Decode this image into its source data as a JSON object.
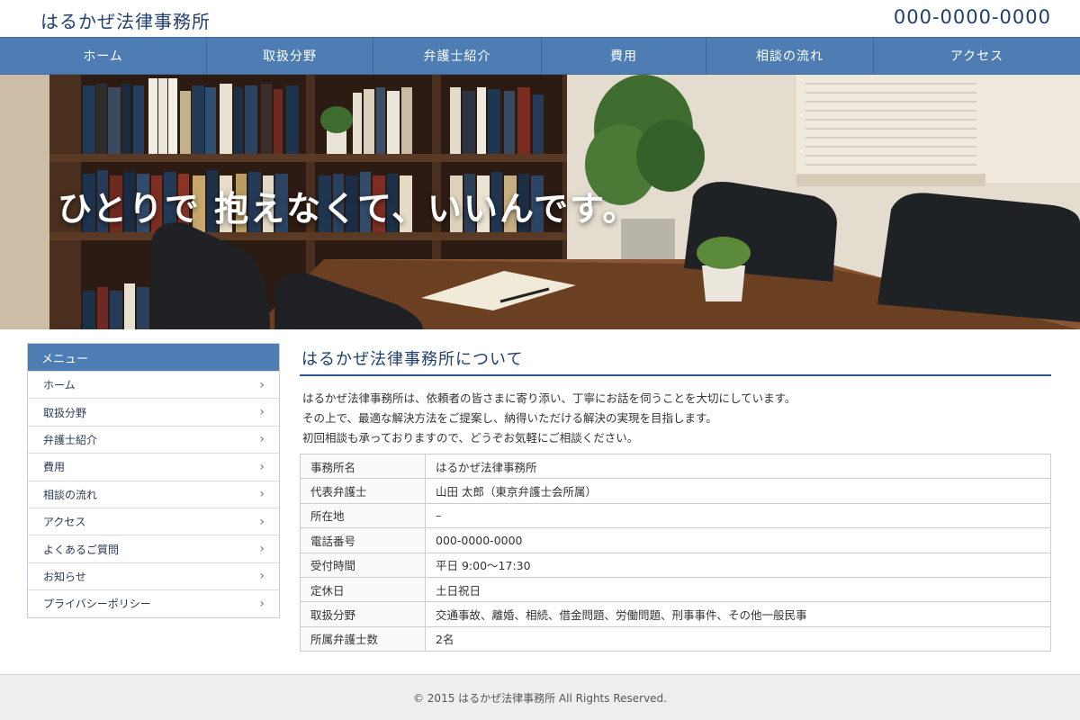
{
  "header": {
    "site_title": "はるかぜ法律事務所",
    "phone": "000-0000-0000"
  },
  "nav": {
    "items": [
      {
        "label": "ホーム"
      },
      {
        "label": "取扱分野"
      },
      {
        "label": "弁護士紹介"
      },
      {
        "label": "費用"
      },
      {
        "label": "相談の流れ"
      },
      {
        "label": "アクセス"
      }
    ]
  },
  "hero": {
    "copy": "ひとりで 抱えなくて、いいんです。"
  },
  "sidebar": {
    "heading": "メニュー",
    "chevron": "›",
    "items": [
      {
        "label": "ホーム"
      },
      {
        "label": "取扱分野"
      },
      {
        "label": "弁護士紹介"
      },
      {
        "label": "費用"
      },
      {
        "label": "相談の流れ"
      },
      {
        "label": "アクセス"
      },
      {
        "label": "よくあるご質問"
      },
      {
        "label": "お知らせ"
      },
      {
        "label": "プライバシーポリシー"
      }
    ]
  },
  "main": {
    "title": "はるかぜ法律事務所について",
    "intro": [
      "はるかぜ法律事務所は、依頼者の皆さまに寄り添い、丁寧にお話を伺うことを大切にしています。",
      "その上で、最適な解決方法をご提案し、納得いただける解決の実現を目指します。",
      "初回相談も承っておりますので、どうぞお気軽にご相談ください。"
    ],
    "table": [
      {
        "label": "事務所名",
        "value": "はるかぜ法律事務所"
      },
      {
        "label": "代表弁護士",
        "value": "山田 太郎（東京弁護士会所属）"
      },
      {
        "label": "所在地",
        "value": "–"
      },
      {
        "label": "電話番号",
        "value": "000-0000-0000"
      },
      {
        "label": "受付時間",
        "value": "平日 9:00〜17:30"
      },
      {
        "label": "定休日",
        "value": "土日祝日"
      },
      {
        "label": "取扱分野",
        "value": "交通事故、離婚、相続、借金問題、労働問題、刑事事件、その他一般民事"
      },
      {
        "label": "所属弁護士数",
        "value": "2名"
      }
    ]
  },
  "footer": {
    "copyright": "© 2015 はるかぜ法律事務所 All Rights Reserved."
  },
  "colors": {
    "brand": "#1f3f6e",
    "nav": "#4d7db3"
  }
}
